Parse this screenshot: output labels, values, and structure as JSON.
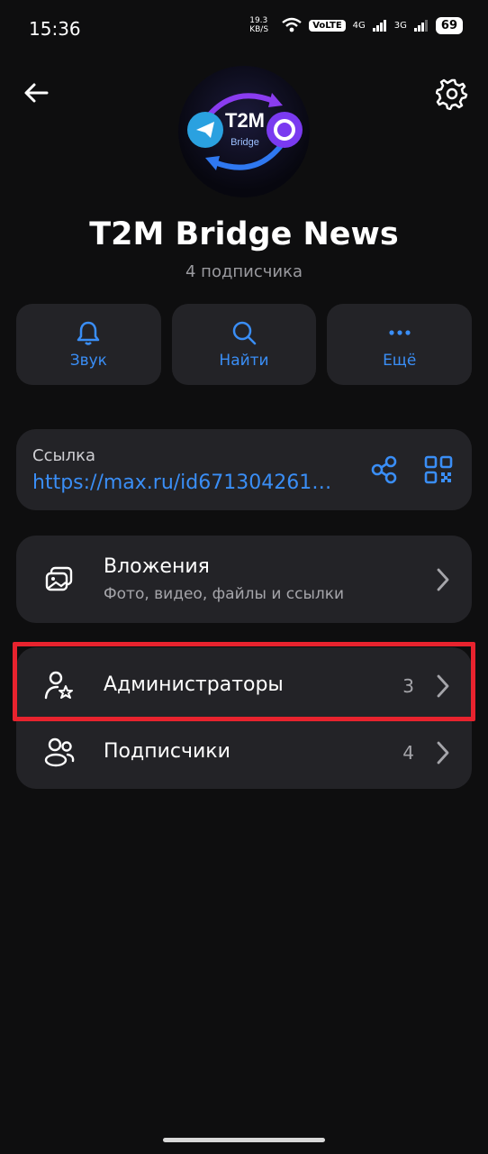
{
  "status_bar": {
    "time": "15:36",
    "net_speed": "19.3 KB/S",
    "volte": "VoLTE",
    "net1": "4G",
    "net2": "3G",
    "battery": "69"
  },
  "header": {
    "back_icon": "arrow-left-icon",
    "settings_icon": "gear-icon",
    "avatar_text": "T2M",
    "avatar_subtext": "Bridge"
  },
  "channel": {
    "title": "T2M Bridge News",
    "subtitle": "4 подписчика"
  },
  "actions": [
    {
      "label": "Звук",
      "icon": "bell-icon"
    },
    {
      "label": "Найти",
      "icon": "search-icon"
    },
    {
      "label": "Ещё",
      "icon": "more-dots-icon"
    }
  ],
  "link": {
    "label": "Ссылка",
    "url": "https://max.ru/id6713042618..."
  },
  "attachments": {
    "title": "Вложения",
    "subtitle": "Фото, видео, файлы и ссылки"
  },
  "members": {
    "admins": {
      "label": "Администраторы",
      "count": "3"
    },
    "subscribers": {
      "label": "Подписчики",
      "count": "4"
    }
  },
  "colors": {
    "accent": "#3a8ef6",
    "highlight": "#e8232e",
    "card": "#232327",
    "background": "#0e0e0f"
  }
}
